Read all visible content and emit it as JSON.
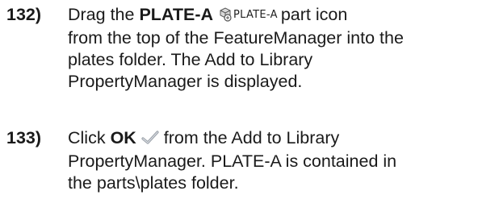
{
  "steps": [
    {
      "number": "132)",
      "line1_pre": "Drag the ",
      "line1_bold": "PLATE-A",
      "part_label": "PLATE-A",
      "line1_post": "part icon",
      "line2": "from the top of the FeatureManager into the",
      "line3": "plates folder. The Add to Library",
      "line4": "PropertyManager is displayed."
    },
    {
      "number": "133)",
      "line1_pre": "Click ",
      "line1_bold": "OK",
      "line1_post": " from the Add to Library",
      "line2": "PropertyManager. PLATE-A is contained in",
      "line3": "the parts\\plates folder."
    }
  ],
  "icons": {
    "part_icon": "part-icon",
    "ok_icon": "checkmark-icon"
  }
}
